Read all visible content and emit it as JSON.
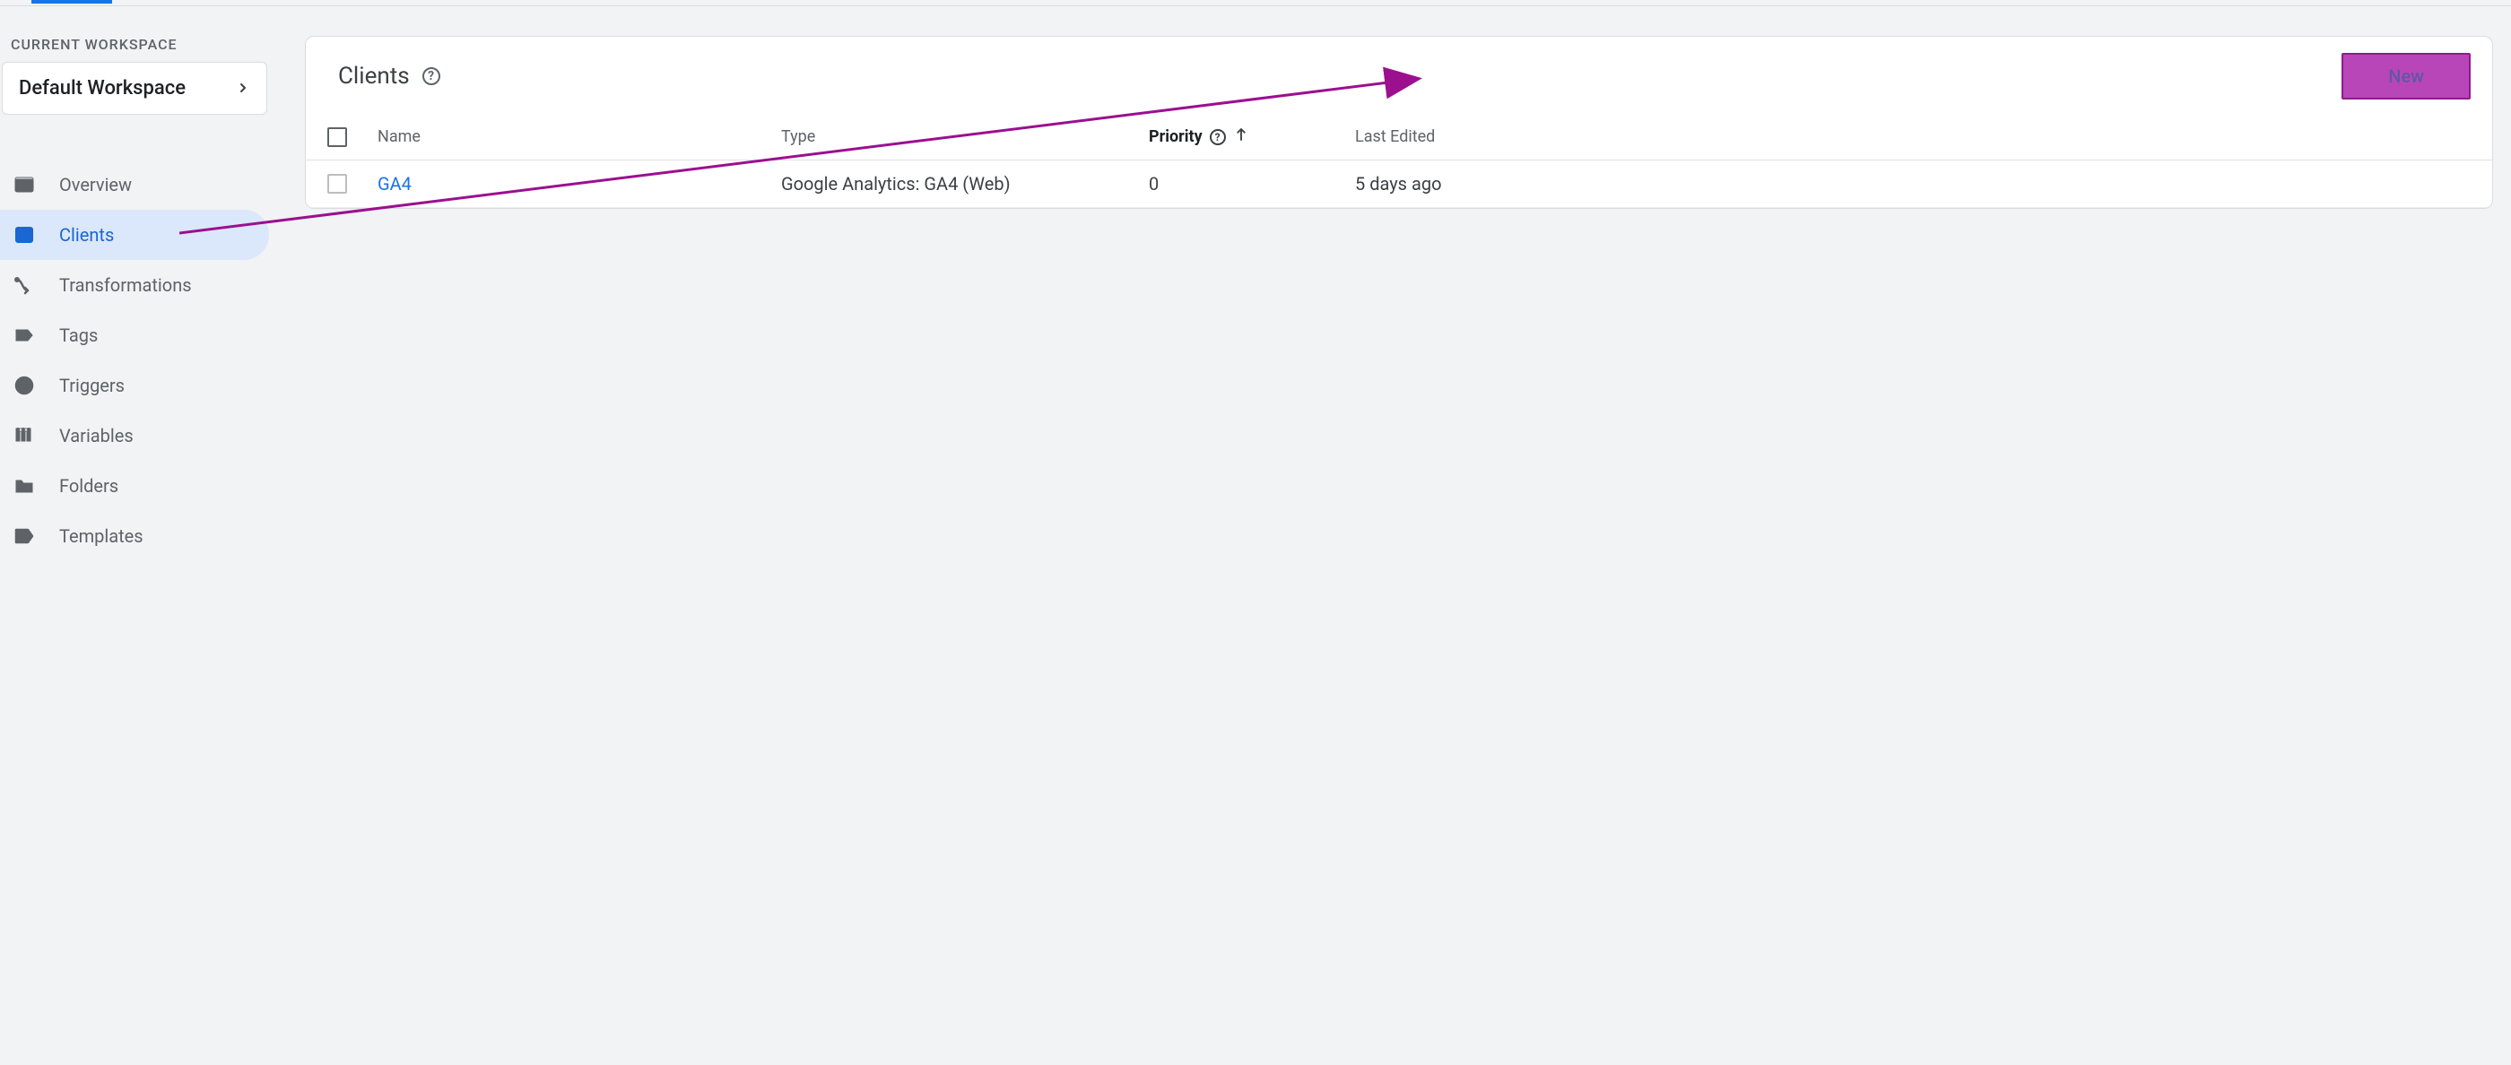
{
  "workspace": {
    "section_label": "CURRENT WORKSPACE",
    "name": "Default Workspace"
  },
  "nav": {
    "items": [
      {
        "id": "overview",
        "label": "Overview"
      },
      {
        "id": "clients",
        "label": "Clients"
      },
      {
        "id": "transformations",
        "label": "Transformations"
      },
      {
        "id": "tags",
        "label": "Tags"
      },
      {
        "id": "triggers",
        "label": "Triggers"
      },
      {
        "id": "variables",
        "label": "Variables"
      },
      {
        "id": "folders",
        "label": "Folders"
      },
      {
        "id": "templates",
        "label": "Templates"
      }
    ],
    "active_id": "clients"
  },
  "panel": {
    "title": "Clients",
    "new_button": "New",
    "columns": {
      "name": "Name",
      "type": "Type",
      "priority": "Priority",
      "last_edited": "Last Edited"
    },
    "rows": [
      {
        "name": "GA4",
        "type": "Google Analytics: GA4 (Web)",
        "priority": "0",
        "last_edited": "5 days ago"
      }
    ]
  },
  "annotation": {
    "highlight_color": "#b63db6",
    "arrow_color": "#9c0f8f"
  }
}
